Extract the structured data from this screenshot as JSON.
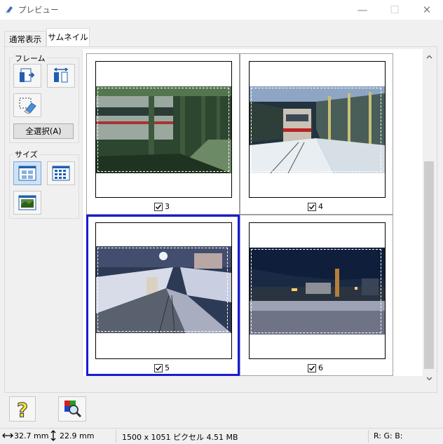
{
  "window": {
    "title": "プレビュー",
    "minimize": "—",
    "maximize": "☐",
    "close": "✕"
  },
  "tabs": [
    {
      "label": "通常表示"
    },
    {
      "label": "サムネイル",
      "active": true
    }
  ],
  "frame_group": {
    "label": "フレーム",
    "select_all_label": "全選択(A)"
  },
  "size_group": {
    "label": "サイズ"
  },
  "thumbnails": [
    {
      "number": "3",
      "checked": true,
      "selected": false
    },
    {
      "number": "4",
      "checked": true,
      "selected": false
    },
    {
      "number": "5",
      "checked": true,
      "selected": true
    },
    {
      "number": "6",
      "checked": true,
      "selected": false
    }
  ],
  "status": {
    "width": "32.7 mm",
    "height": "22.9 mm",
    "info": "1500 x 1051 ピクセル 4.51 MB",
    "rgb": "R: G: B:"
  },
  "colors": {
    "selection": "#1a1ad6",
    "scroll_thumb": "#cdcdcd"
  }
}
